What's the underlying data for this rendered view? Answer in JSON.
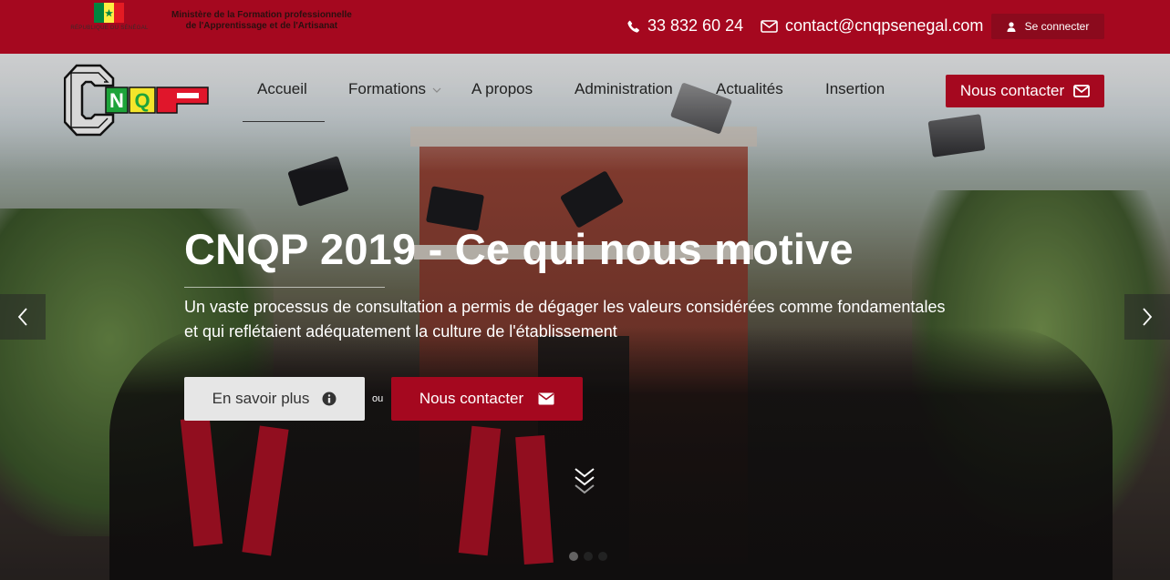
{
  "topbar": {
    "gov_caption": "RÉPUBLIQUE DU SÉNÉGAL",
    "ministry_line1": "Ministère de la Formation professionnelle",
    "ministry_line2": "de l'Apprentissage et de l'Artisanat",
    "phone": "33 832 60 24",
    "email": "contact@cnqpsenegal.com",
    "login_label": "Se connecter",
    "bg_color": "#a5081f"
  },
  "logo": {
    "icon": "cnqp-logo",
    "letters": [
      "C",
      "N",
      "Q",
      "P"
    ]
  },
  "nav": {
    "items": [
      {
        "label": "Accueil",
        "active": true
      },
      {
        "label": "Formations",
        "has_dropdown": true
      },
      {
        "label": "A propos"
      },
      {
        "label": "Administration"
      },
      {
        "label": "Actualités"
      },
      {
        "label": "Insertion"
      }
    ],
    "contact_label": "Nous contacter"
  },
  "slide": {
    "title": "CNQP 2019 - Ce qui nous motive",
    "text_line1": "Un vaste processus de consultation a permis de dégager les valeurs considérées comme fondamentales",
    "text_line2": "et qui reflétaient adéquatement la culture de l'établissement",
    "more_label": "En savoir plus",
    "or_label": "ou",
    "contact_label": "Nous contacter",
    "active_dot": 2,
    "dot_count": 3
  }
}
